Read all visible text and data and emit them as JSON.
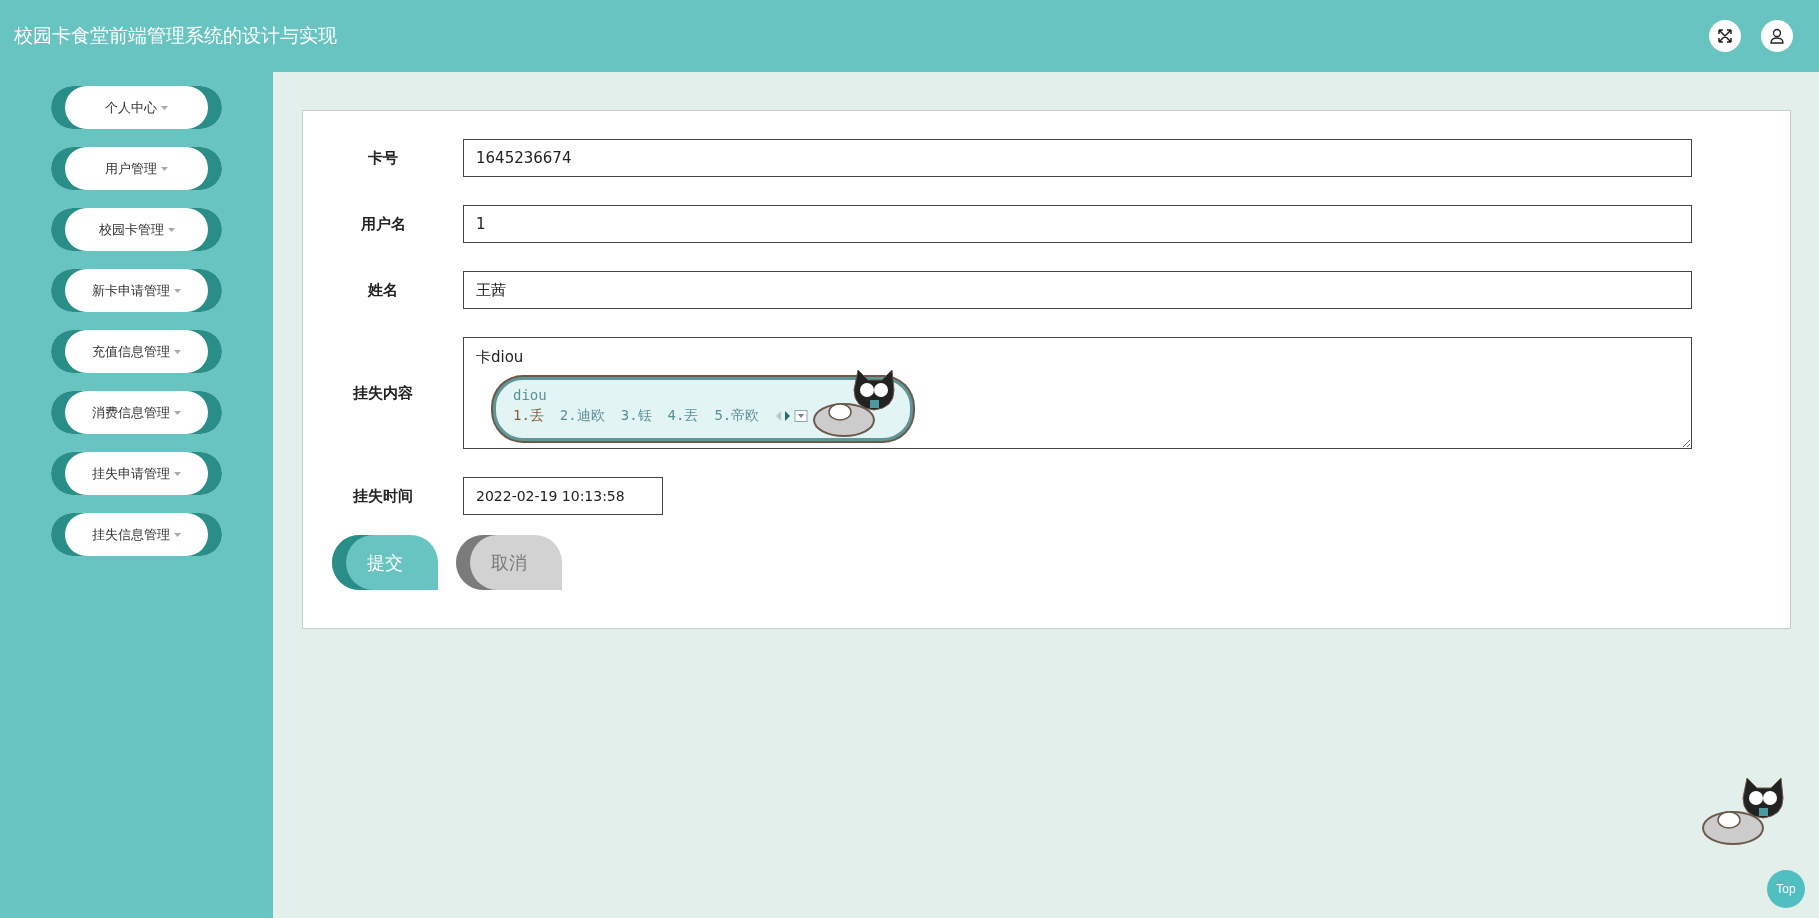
{
  "header": {
    "title": "校园卡食堂前端管理系统的设计与实现"
  },
  "sidebar": {
    "items": [
      {
        "label": "个人中心"
      },
      {
        "label": "用户管理"
      },
      {
        "label": "校园卡管理"
      },
      {
        "label": "新卡申请管理"
      },
      {
        "label": "充值信息管理"
      },
      {
        "label": "消费信息管理"
      },
      {
        "label": "挂失申请管理"
      },
      {
        "label": "挂失信息管理"
      }
    ]
  },
  "form": {
    "fields": [
      {
        "kind": "input",
        "label": "卡号",
        "value": "1645236674"
      },
      {
        "kind": "input",
        "label": "用户名",
        "value": "1"
      },
      {
        "kind": "input",
        "label": "姓名",
        "value": "王茜"
      },
      {
        "kind": "textarea",
        "label": "挂失内容",
        "value": "卡diou"
      },
      {
        "kind": "short",
        "label": "挂失时间",
        "value": "2022-02-19 10:13:58"
      }
    ],
    "buttons": [
      {
        "label": "提交",
        "kind": "primary"
      },
      {
        "label": "取消",
        "kind": "secondary"
      }
    ]
  },
  "ime": {
    "composition": "diou",
    "candidates": [
      "1.丢",
      "2.迪欧",
      "3.铥",
      "4.丟",
      "5.帝欧"
    ]
  },
  "back_to_top": {
    "label": "Top"
  }
}
